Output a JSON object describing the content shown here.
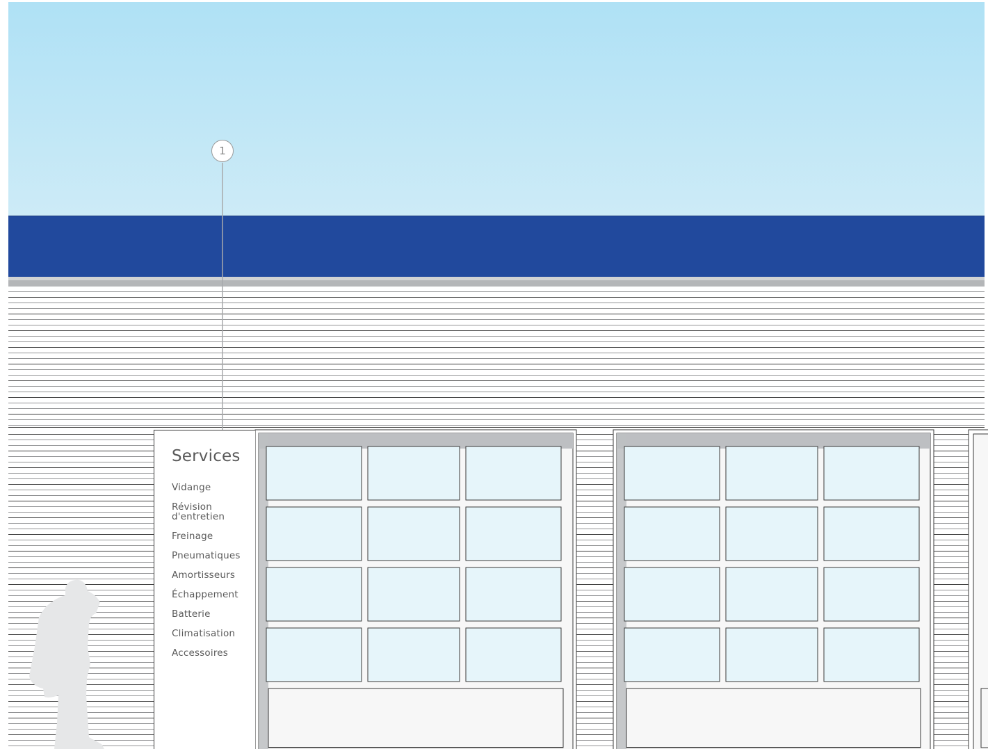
{
  "callout": {
    "number": "1"
  },
  "sign": {
    "title": "Services",
    "items": [
      "Vidange",
      "Révision\nd'entretien",
      "Freinage",
      "Pneumatiques",
      "Amortisseurs",
      "Échappement",
      "Batterie",
      "Climatisation",
      "Accessoires"
    ]
  },
  "colors": {
    "sky_top": "#afe1f5",
    "sky_bottom": "#cdebf7",
    "band": "#21499d",
    "door_glass": "#e6f5fa",
    "door_frame": "#bdbfc2",
    "pedestrian": "#e6e7e8",
    "marker_line": "#a7a9ac"
  },
  "icons": {
    "person": "pedestrian-silhouette-icon"
  }
}
